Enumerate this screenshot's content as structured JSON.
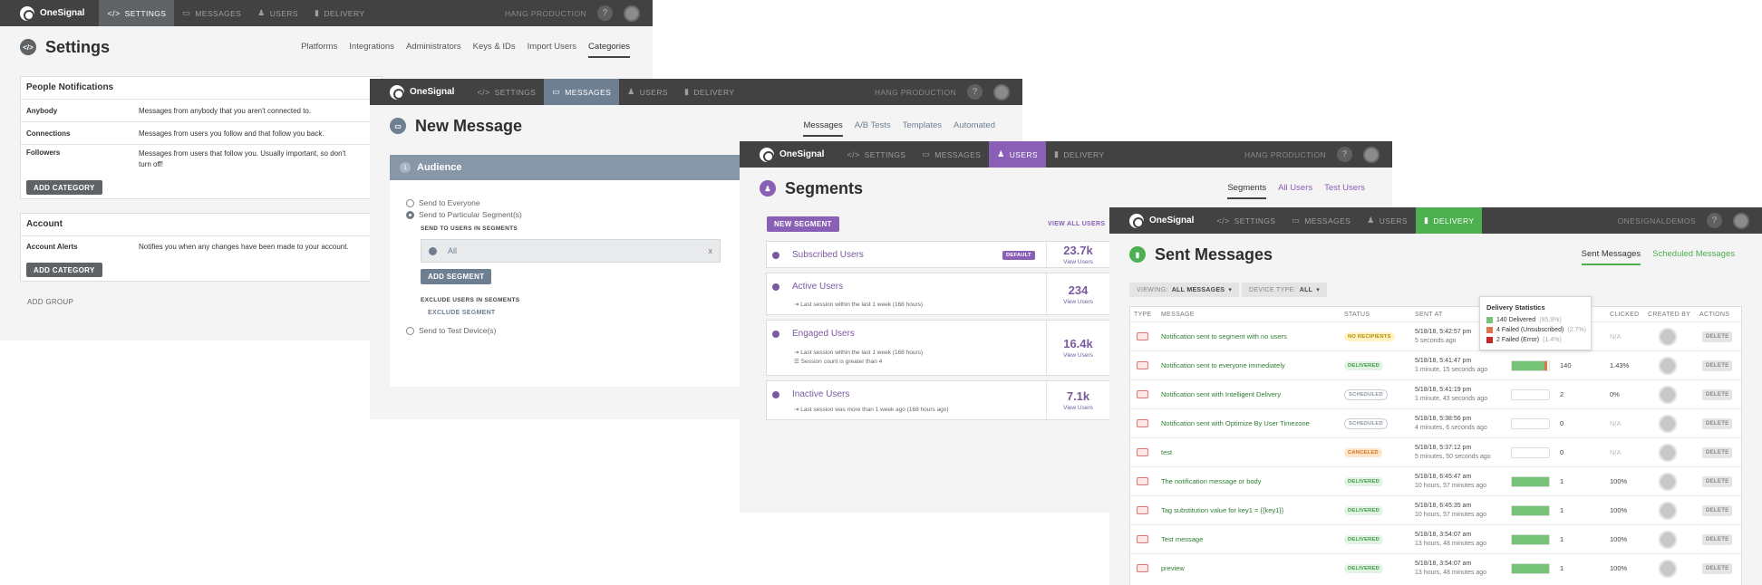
{
  "brand": "OneSignal",
  "nav": {
    "settings": "SETTINGS",
    "messages": "MESSAGES",
    "users": "USERS",
    "delivery": "DELIVERY"
  },
  "help": "?",
  "settings": {
    "org": "HANG PRODUCTION",
    "title": "Settings",
    "tabs": [
      "Platforms",
      "Integrations",
      "Administrators",
      "Keys & IDs",
      "Import Users",
      "Categories"
    ],
    "people": {
      "heading": "People Notifications",
      "rows": [
        {
          "name": "Anybody",
          "desc": "Messages from anybody that you aren't connected to."
        },
        {
          "name": "Connections",
          "desc": "Messages from users you follow and that follow you back."
        },
        {
          "name": "Followers",
          "desc": "Messages from users that follow you. Usually important, so don't turn off!"
        }
      ],
      "add": "ADD CATEGORY"
    },
    "account": {
      "heading": "Account",
      "rows": [
        {
          "name": "Account Alerts",
          "desc": "Notifies you when any changes have been made to your account."
        }
      ],
      "add": "ADD CATEGORY"
    },
    "add_group": "ADD GROUP"
  },
  "message": {
    "org": "HANG PRODUCTION",
    "title": "New Message",
    "tabs": [
      "Messages",
      "A/B Tests",
      "Templates",
      "Automated"
    ],
    "step": "1",
    "audience": "Audience",
    "opt_everyone": "Send to Everyone",
    "opt_segments": "Send to Particular Segment(s)",
    "send_label": "SEND TO USERS IN SEGMENTS",
    "segment_chip": "All",
    "chip_close": "x",
    "add_segment": "ADD SEGMENT",
    "exclude_label": "EXCLUDE USERS IN SEGMENTS",
    "exclude_btn": "EXCLUDE SEGMENT",
    "opt_test": "Send to Test Device(s)"
  },
  "segments": {
    "org": "HANG PRODUCTION",
    "title": "Segments",
    "tabs": [
      "Segments",
      "All Users",
      "Test Users"
    ],
    "new_btn": "NEW SEGMENT",
    "view_all": "VIEW ALL USERS",
    "view_users": "View Users",
    "items": [
      {
        "name": "Subscribed Users",
        "badge": "DEFAULT",
        "rules": [],
        "count": "23.7k"
      },
      {
        "name": "Active Users",
        "badge": "",
        "rules": [
          "Last session within the last 1 week (168 hours)"
        ],
        "count": "234"
      },
      {
        "name": "Engaged Users",
        "badge": "",
        "rules": [
          "Last session within the last 1 week (168 hours)",
          "Session count is greater than 4"
        ],
        "count": "16.4k"
      },
      {
        "name": "Inactive Users",
        "badge": "",
        "rules": [
          "Last session was more than 1 week ago (168 hours ago)"
        ],
        "count": "7.1k"
      }
    ]
  },
  "sent": {
    "org": "ONESIGNALDEMOS",
    "title": "Sent Messages",
    "tabs": [
      "Sent Messages",
      "Scheduled Messages"
    ],
    "filter1_label": "VIEWING:",
    "filter1_value": "ALL MESSAGES",
    "filter2_label": "DEVICE TYPE:",
    "filter2_value": "ALL",
    "columns": [
      "TYPE",
      "MESSAGE",
      "STATUS",
      "SENT AT",
      "CLICKED",
      "CREATED BY",
      "ACTIONS"
    ],
    "tooltip": {
      "title": "Delivery Statistics",
      "lines": [
        {
          "text": "140 Delivered",
          "pct": "(95.9%)",
          "color": "#76c477"
        },
        {
          "text": "4 Failed (Unsubscribed)",
          "pct": "(2.7%)",
          "color": "#e2734a"
        },
        {
          "text": "2 Failed (Error)",
          "pct": "(1.4%)",
          "color": "#c62828"
        }
      ]
    },
    "delete": "DELETE",
    "rows": [
      {
        "msg": "Notification sent to segment with no users",
        "status": "NO RECIPIENTS",
        "date": "5/18/18, 5:42:57 pm",
        "ago": "5 seconds ago",
        "count": "",
        "clicked": "N/A",
        "fill": 0
      },
      {
        "msg": "Notification sent to everyone immediately",
        "status": "DELIVERED",
        "date": "5/18/18, 5:41:47 pm",
        "ago": "1 minute, 15 seconds ago",
        "count": "140",
        "clicked": "1.43%",
        "fill": 0.96
      },
      {
        "msg": "Notification sent with Intelligent Delivery",
        "status": "SCHEDULED",
        "date": "5/18/18, 5:41:19 pm",
        "ago": "1 minute, 43 seconds ago",
        "count": "2",
        "clicked": "0%",
        "fill": 0
      },
      {
        "msg": "Notification sent with Optimize By User Timezone",
        "status": "SCHEDULED",
        "date": "5/18/18, 5:38:56 pm",
        "ago": "4 minutes, 6 seconds ago",
        "count": "0",
        "clicked": "N/A",
        "fill": 0
      },
      {
        "msg": "test",
        "status": "CANCELED",
        "date": "5/18/18, 5:37:12 pm",
        "ago": "5 minutes, 50 seconds ago",
        "count": "0",
        "clicked": "N/A",
        "fill": 0
      },
      {
        "msg": "The notification message or body",
        "status": "DELIVERED",
        "date": "5/18/18, 6:45:47 am",
        "ago": "10 hours, 57 minutes ago",
        "count": "1",
        "clicked": "100%",
        "fill": 1
      },
      {
        "msg": "Tag substitution value for key1 = {{key1}}",
        "status": "DELIVERED",
        "date": "5/18/18, 6:45:35 am",
        "ago": "10 hours, 57 minutes ago",
        "count": "1",
        "clicked": "100%",
        "fill": 1
      },
      {
        "msg": "Test message",
        "status": "DELIVERED",
        "date": "5/18/18, 3:54:07 am",
        "ago": "13 hours, 48 minutes ago",
        "count": "1",
        "clicked": "100%",
        "fill": 1
      },
      {
        "msg": "preview",
        "status": "DELIVERED",
        "date": "5/18/18, 3:54:07 am",
        "ago": "13 hours, 48 minutes ago",
        "count": "1",
        "clicked": "100%",
        "fill": 1
      }
    ]
  },
  "colors": {
    "settings": "#5f6366",
    "messages": "#6e7f92",
    "users": "#8a5fb6",
    "delivery": "#4caf50",
    "topbar": "#424242"
  }
}
